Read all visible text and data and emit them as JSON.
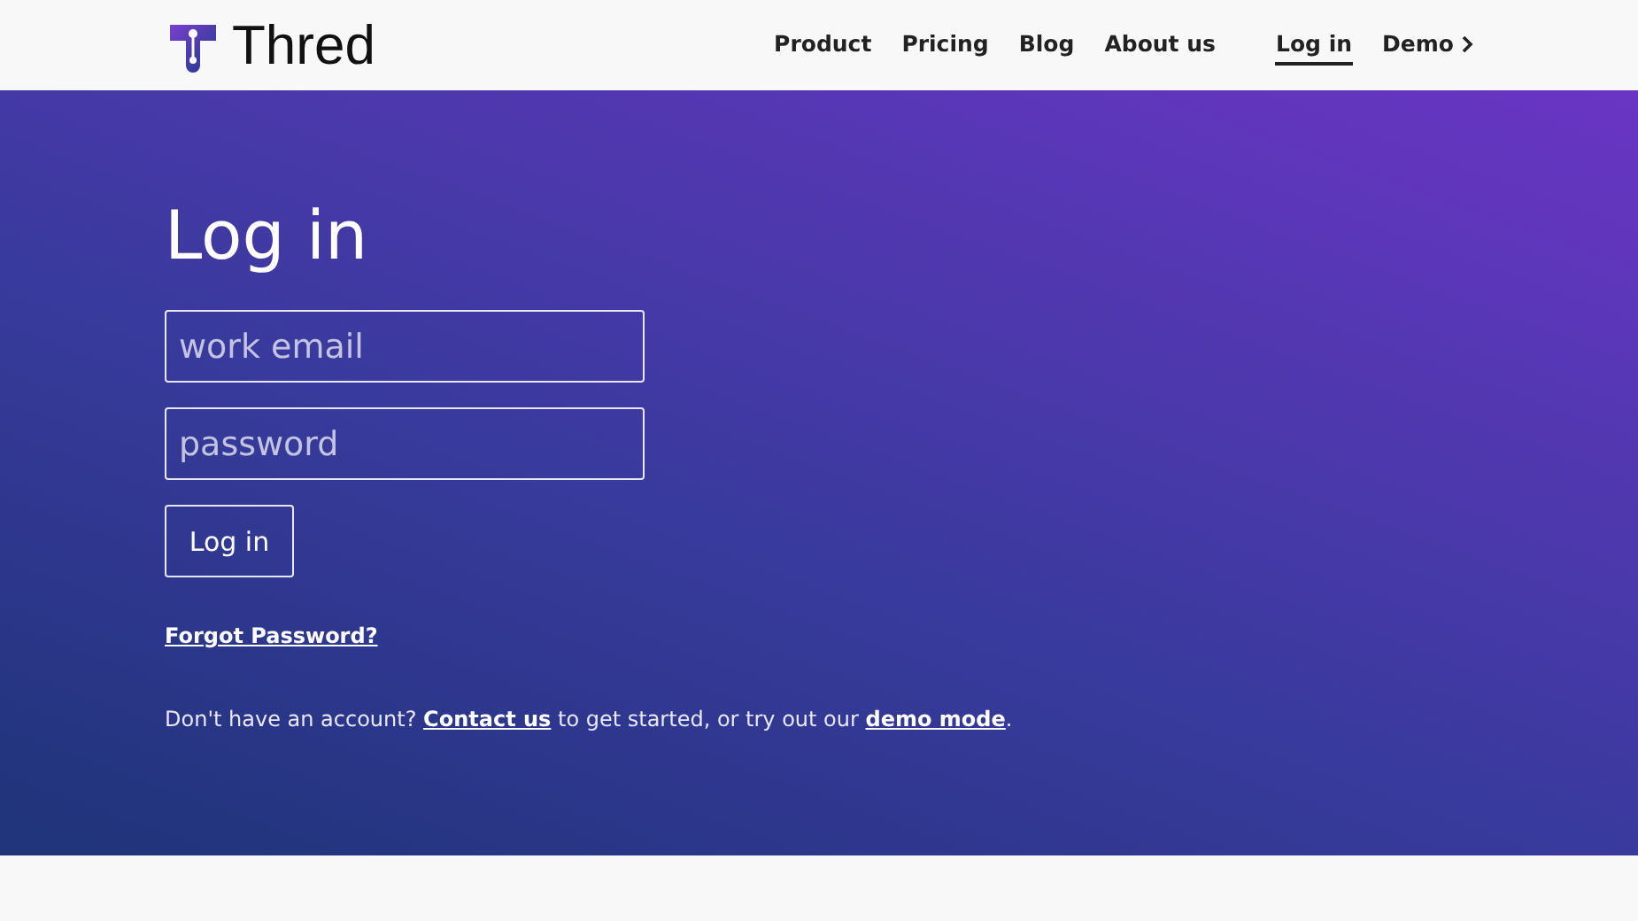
{
  "header": {
    "brand": "Thred",
    "nav": [
      {
        "label": "Product",
        "selected": false
      },
      {
        "label": "Pricing",
        "selected": false
      },
      {
        "label": "Blog",
        "selected": false
      },
      {
        "label": "About us",
        "selected": false
      },
      {
        "label": "Log in",
        "selected": true
      },
      {
        "label": "Demo",
        "selected": false,
        "kind": "chevron"
      }
    ]
  },
  "login": {
    "title": "Log in",
    "email": {
      "placeholder": "work email"
    },
    "password": {
      "placeholder": "password"
    },
    "submit": "Log in",
    "forgot": "Forgot Password?",
    "note": [
      {
        "kind": "text",
        "text": "Don't have an account? "
      },
      {
        "kind": "link",
        "text": "Contact us"
      },
      {
        "kind": "text",
        "text": " to get started, or try out our "
      },
      {
        "kind": "link",
        "text": "demo mode"
      },
      {
        "kind": "text",
        "text": "."
      }
    ]
  }
}
